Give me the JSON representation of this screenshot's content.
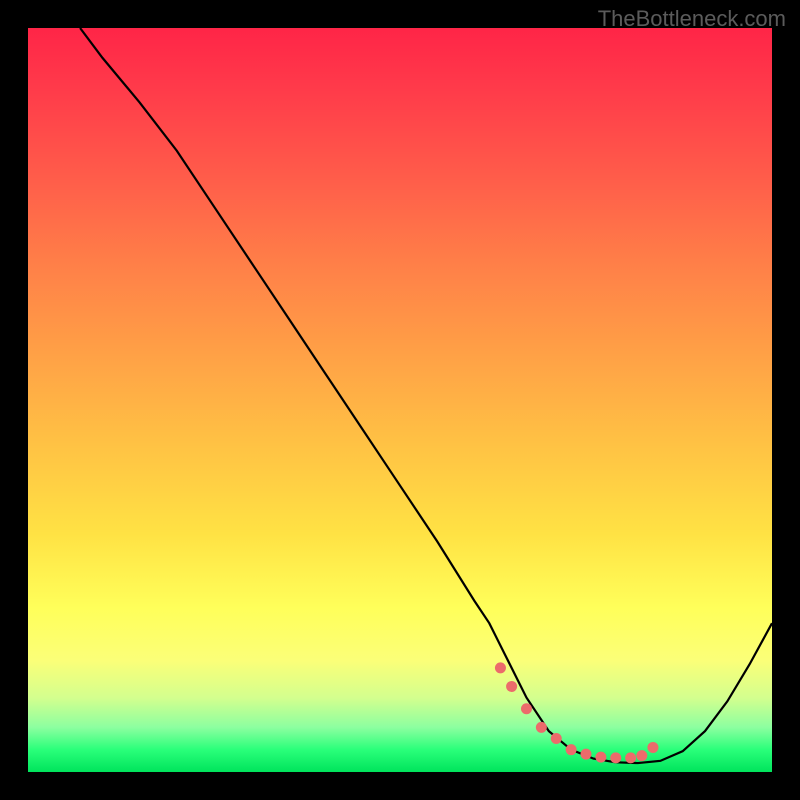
{
  "watermark": "TheBottleneck.com",
  "chart_data": {
    "type": "line",
    "title": "",
    "xlabel": "",
    "ylabel": "",
    "xlim": [
      0,
      100
    ],
    "ylim": [
      0,
      100
    ],
    "series": [
      {
        "name": "bottleneck-curve",
        "x": [
          7,
          10,
          15,
          20,
          25,
          30,
          35,
          40,
          45,
          50,
          55,
          60,
          62,
          64,
          67,
          70,
          73,
          76,
          79,
          82,
          85,
          88,
          91,
          94,
          97,
          100
        ],
        "y": [
          100,
          96,
          90,
          83.5,
          76,
          68.5,
          61,
          53.5,
          46,
          38.5,
          31,
          23,
          20,
          16,
          10,
          5.5,
          3,
          1.8,
          1.3,
          1.2,
          1.5,
          2.8,
          5.5,
          9.5,
          14.5,
          20
        ]
      }
    ],
    "markers": {
      "name": "highlight-points",
      "color": "#ec6b6b",
      "x": [
        63.5,
        65,
        67,
        69,
        71,
        73,
        75,
        77,
        79,
        81,
        82.5,
        84
      ],
      "y": [
        14,
        11.5,
        8.5,
        6,
        4.5,
        3,
        2.4,
        2,
        1.9,
        1.9,
        2.2,
        3.3
      ]
    }
  }
}
